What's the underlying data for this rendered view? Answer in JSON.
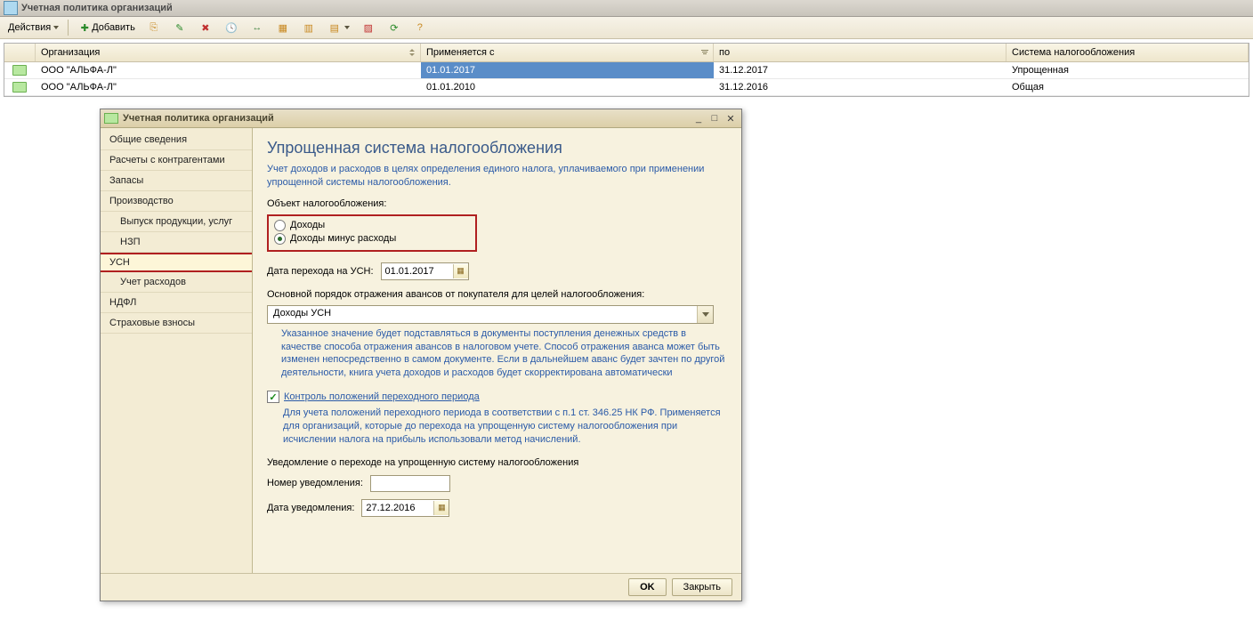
{
  "window_title": "Учетная политика организаций",
  "toolbar": {
    "actions": "Действия",
    "add": "Добавить"
  },
  "grid": {
    "headers": {
      "org": "Организация",
      "from": "Применяется с",
      "to": "по",
      "sys": "Система налогообложения"
    },
    "rows": [
      {
        "org": "ООО \"АЛЬФА-Л\"",
        "from": "01.01.2017",
        "to": "31.12.2017",
        "sys": "Упрощенная"
      },
      {
        "org": "ООО \"АЛЬФА-Л\"",
        "from": "01.01.2010",
        "to": "31.12.2016",
        "sys": "Общая"
      }
    ]
  },
  "dialog": {
    "title": "Учетная политика организаций",
    "nav": {
      "general": "Общие сведения",
      "contractors": "Расчеты с контрагентами",
      "stock": "Запасы",
      "production": "Производство",
      "output": "Выпуск продукции, услуг",
      "nzp": "НЗП",
      "usn": "УСН",
      "expenses": "Учет расходов",
      "ndfl": "НДФЛ",
      "insurance": "Страховые взносы"
    },
    "content": {
      "heading": "Упрощенная система налогообложения",
      "desc": "Учет доходов и расходов в целях определения единого налога, уплачиваемого при применении упрощенной системы налогообложения.",
      "object_label": "Объект налогообложения:",
      "radio_income": "Доходы",
      "radio_income_minus": "Доходы минус расходы",
      "transition_date_label": "Дата перехода на УСН:",
      "transition_date": "01.01.2017",
      "advance_label": "Основной порядок отражения авансов от покупателя для целей налогообложения:",
      "advance_value": "Доходы УСН",
      "advance_help": "Указанное значение будет подставляться в документы поступления денежных средств в качестве способа отражения авансов в налоговом учете.\nСпособ отражения аванса может быть изменен непосредственно в самом документе. Если в дальнейшем аванс будет зачтен по другой деятельности, книга учета доходов и расходов будет скорректирована автоматически",
      "checkbox_label": "Контроль положений переходного периода",
      "checkbox_help": "Для учета положений переходного периода в соответствии с п.1 ст. 346.25 НК РФ. Применяется для организаций, которые до перехода на упрощенную систему налогообложения при исчислении налога на прибыль использовали метод начислений.",
      "notification_heading": "Уведомление о переходе на упрощенную систему налогообложения",
      "notif_number_label": "Номер уведомления:",
      "notif_number": "",
      "notif_date_label": "Дата уведомления:",
      "notif_date": "27.12.2016"
    },
    "buttons": {
      "ok": "OK",
      "close": "Закрыть"
    }
  }
}
